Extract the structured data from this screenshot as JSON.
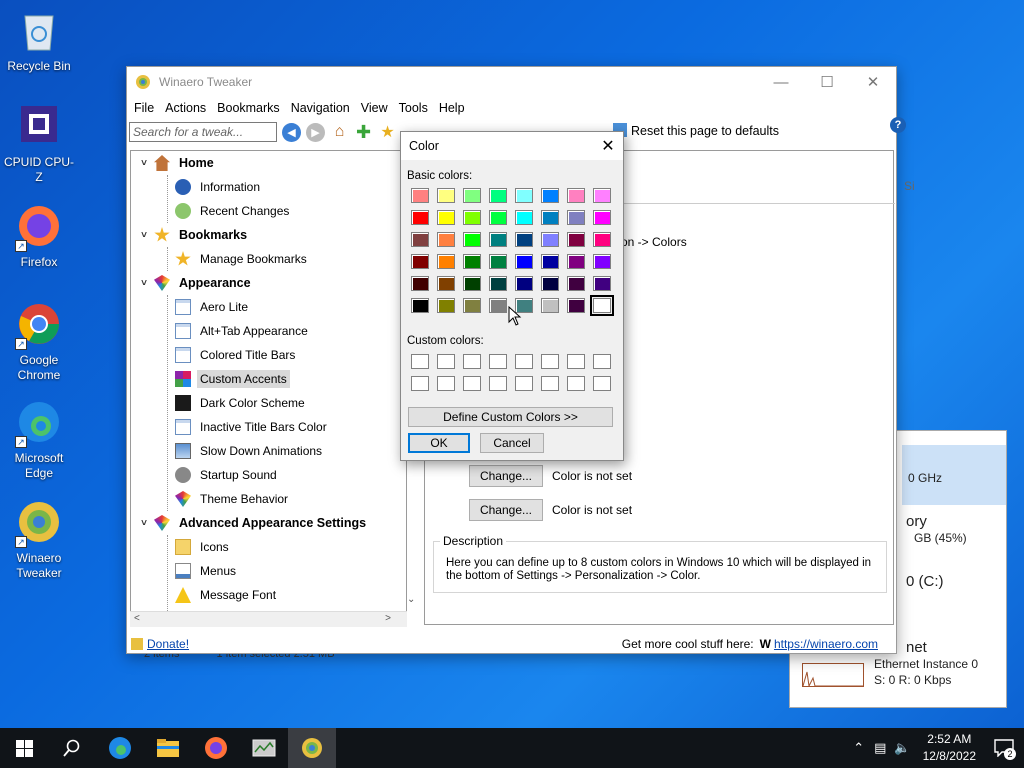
{
  "desktop": {
    "icons": [
      {
        "label": "Recycle Bin",
        "icon": "recycle-bin-icon"
      },
      {
        "label": "CPUID CPU-Z",
        "icon": "cpuz-icon"
      },
      {
        "label": "Firefox",
        "icon": "firefox-icon"
      },
      {
        "label": "Google Chrome",
        "icon": "chrome-icon"
      },
      {
        "label": "Microsoft Edge",
        "icon": "edge-icon"
      },
      {
        "label": "Winaero Tweaker",
        "icon": "winaero-icon"
      }
    ]
  },
  "background_window": {
    "cpu_speed": "0 GHz",
    "memory_label": "ory",
    "memory_value": "GB (45%)",
    "disk": "0 (C:)",
    "net_label": "net",
    "net_instance": "Ethernet Instance 0",
    "net_rate": "S: 0 R: 0 Kbps",
    "status_items": "2 items",
    "status_selected": "1 item selected  2.51 MB"
  },
  "main_window": {
    "title": "Winaero Tweaker",
    "menu": [
      "File",
      "Actions",
      "Bookmarks",
      "Navigation",
      "View",
      "Tools",
      "Help"
    ],
    "search_placeholder": "Search for a tweak...",
    "reset_label": "Reset this page to defaults",
    "tree": [
      {
        "type": "group",
        "label": "Home",
        "icon": "home-icon"
      },
      {
        "type": "child",
        "label": "Information",
        "icon": "info-icon"
      },
      {
        "type": "child",
        "label": "Recent Changes",
        "icon": "recent-icon"
      },
      {
        "type": "group",
        "label": "Bookmarks",
        "icon": "star-icon"
      },
      {
        "type": "child",
        "label": "Manage Bookmarks",
        "icon": "star-icon"
      },
      {
        "type": "group",
        "label": "Appearance",
        "icon": "appearance-icon"
      },
      {
        "type": "child",
        "label": "Aero Lite",
        "icon": "window-icon"
      },
      {
        "type": "child",
        "label": "Alt+Tab Appearance",
        "icon": "window-icon"
      },
      {
        "type": "child",
        "label": "Colored Title Bars",
        "icon": "window-icon"
      },
      {
        "type": "child",
        "label": "Custom Accents",
        "icon": "accents-icon",
        "selected": true
      },
      {
        "type": "child",
        "label": "Dark Color Scheme",
        "icon": "dark-icon"
      },
      {
        "type": "child",
        "label": "Inactive Title Bars Color",
        "icon": "window-icon"
      },
      {
        "type": "child",
        "label": "Slow Down Animations",
        "icon": "animation-icon"
      },
      {
        "type": "child",
        "label": "Startup Sound",
        "icon": "sound-icon"
      },
      {
        "type": "child",
        "label": "Theme Behavior",
        "icon": "appearance-icon"
      },
      {
        "type": "group",
        "label": "Advanced Appearance Settings",
        "icon": "appearance-icon"
      },
      {
        "type": "child",
        "label": "Icons",
        "icon": "folder-icon"
      },
      {
        "type": "child",
        "label": "Menus",
        "icon": "menu-icon"
      },
      {
        "type": "child",
        "label": "Message Font",
        "icon": "warning-icon"
      }
    ],
    "breadcrumb_fragment": "on -> Colors",
    "change_rows": [
      {
        "button": "Change...",
        "status": "Color is not set"
      },
      {
        "button": "Change...",
        "status": "Color is not set"
      }
    ],
    "description_title": "Description",
    "description_text": "Here you can define up to 8 custom colors in Windows 10 which will be displayed in the bottom of Settings -> Personalization -> Color.",
    "donate_label": "Donate!",
    "more_stuff_label": "Get more cool stuff here:",
    "site_link": "https://winaero.com",
    "right_fragment_si": "Si"
  },
  "color_dialog": {
    "title": "Color",
    "basic_label": "Basic colors:",
    "custom_label": "Custom colors:",
    "define_button": "Define Custom Colors >>",
    "ok_button": "OK",
    "cancel_button": "Cancel",
    "basic_colors": [
      "#ff8080",
      "#ffff80",
      "#80ff80",
      "#00ff80",
      "#80ffff",
      "#0080ff",
      "#ff80c0",
      "#ff80ff",
      "#ff0000",
      "#ffff00",
      "#80ff00",
      "#00ff40",
      "#00ffff",
      "#0080c0",
      "#8080c0",
      "#ff00ff",
      "#804040",
      "#ff8040",
      "#00ff00",
      "#008080",
      "#004080",
      "#8080ff",
      "#800040",
      "#ff0080",
      "#800000",
      "#ff8000",
      "#008000",
      "#008040",
      "#0000ff",
      "#0000a0",
      "#800080",
      "#8000ff",
      "#400000",
      "#804000",
      "#004000",
      "#004040",
      "#000080",
      "#000040",
      "#400040",
      "#400080",
      "#000000",
      "#808000",
      "#808040",
      "#808080",
      "#408080",
      "#c0c0c0",
      "#400040",
      "#ffffff"
    ],
    "selected_index": 47,
    "custom_count": 16
  },
  "taskbar": {
    "time": "2:52 AM",
    "date": "12/8/2022",
    "notification_count": "2"
  }
}
